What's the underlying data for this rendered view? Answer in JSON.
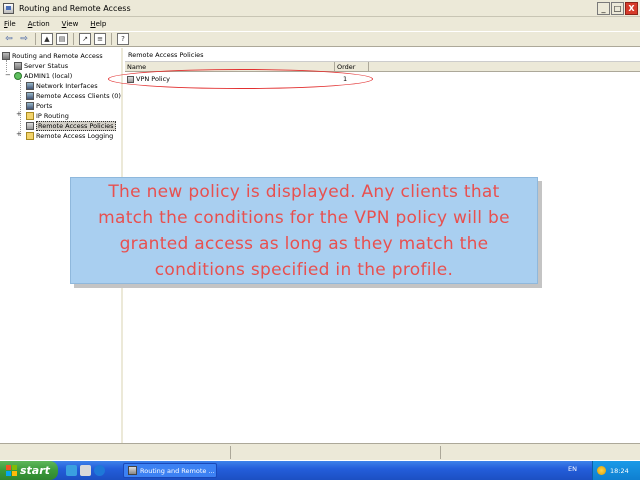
{
  "window": {
    "title": "Routing and Remote Access",
    "buttons": {
      "minimize": "_",
      "maximize": "□",
      "close": "X"
    }
  },
  "menu": {
    "file": {
      "key": "F",
      "rest": "ile"
    },
    "action": {
      "key": "A",
      "rest": "ction"
    },
    "view": {
      "key": "V",
      "rest": "iew"
    },
    "help": {
      "key": "H",
      "rest": "elp"
    }
  },
  "toolbar": {
    "icons": [
      "back-icon",
      "forward-icon",
      "up-folder-icon",
      "show-hide-tree-icon",
      "export-list-icon",
      "properties-icon",
      "help-icon"
    ]
  },
  "tree": {
    "root": "Routing and Remote Access",
    "server_status": "Server Status",
    "server": "ADMIN1 (local)",
    "items": [
      "Network Interfaces",
      "Remote Access Clients (0)",
      "Ports",
      "IP Routing",
      "Remote Access Policies",
      "Remote Access Logging"
    ]
  },
  "details": {
    "header": "Remote Access Policies",
    "columns": {
      "name": "Name",
      "order": "Order"
    },
    "rows": [
      {
        "name": "VPN Policy",
        "order": "1"
      }
    ]
  },
  "callout": {
    "text": "The new policy is displayed. Any clients that match the conditions for the VPN policy will be granted access as long as they match the conditions specified in the profile."
  },
  "taskbar": {
    "start_label": "start",
    "task_label": "Routing and Remote ...",
    "language": "EN",
    "clock": "18:24"
  },
  "colors": {
    "callout_bg": "#a9cff0",
    "callout_text": "#e8504f",
    "highlight_ellipse": "#e23030",
    "taskbar_blue": "#245edb",
    "start_green": "#3a9a3a"
  }
}
